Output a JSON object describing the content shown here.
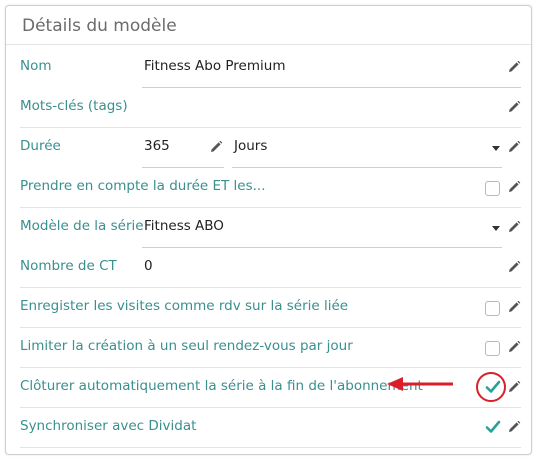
{
  "panel": {
    "title": "Détails du modèle"
  },
  "fields": {
    "nom": {
      "label": "Nom",
      "value": "Fitness Abo Premium"
    },
    "mots_cles": {
      "label": "Mots-clés (tags)",
      "value": ""
    },
    "duree": {
      "label": "Durée",
      "value": "365",
      "unit": "Jours"
    },
    "prendre_compte": {
      "label": "Prendre en compte la durée ET les...",
      "checked": false
    },
    "modele_serie": {
      "label": "Modèle de la série",
      "value": "Fitness ABO"
    },
    "nombre_ct": {
      "label": "Nombre de CT",
      "value": "0"
    },
    "enregistrer_visites": {
      "label": "Enregister les visites comme rdv sur la série liée",
      "checked": false
    },
    "limiter_creation": {
      "label": "Limiter la création à un seul rendez-vous par jour",
      "checked": false
    },
    "cloturer_auto": {
      "label": "Clôturer automatiquement la série à la fin de l'abonnement",
      "checked": true
    },
    "synchroniser": {
      "label": "Synchroniser avec Dividat",
      "checked": true
    }
  },
  "icons": {
    "edit": "pencil-icon",
    "dropdown": "caret-down-icon",
    "checked": "checkmark-icon"
  },
  "colors": {
    "label": "#3a8f8f",
    "check": "#2aa198",
    "annotation": "#d9202a"
  }
}
